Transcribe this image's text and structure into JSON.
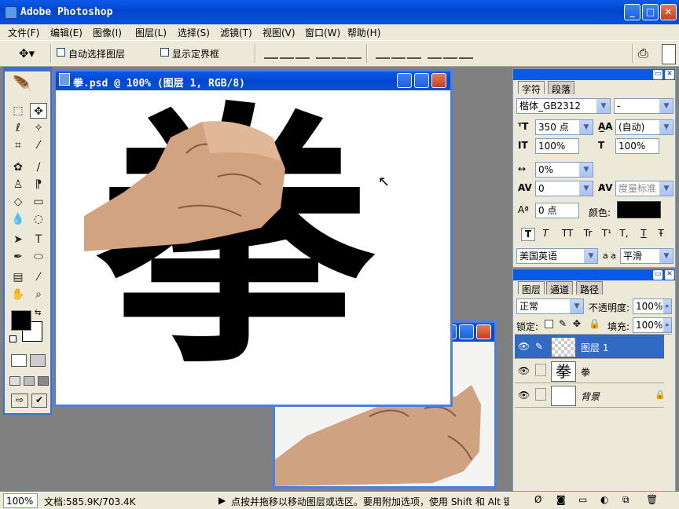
{
  "app": {
    "title": "Adobe Photoshop",
    "min": "_",
    "max": "□",
    "close": "✕"
  },
  "menu": [
    "文件(F)",
    "编辑(E)",
    "图像(I)",
    "图层(L)",
    "选择(S)",
    "滤镜(T)",
    "视图(V)",
    "窗口(W)",
    "帮助(H)"
  ],
  "options": {
    "auto_select": "自动选择图层",
    "show_bounds": "显示定界框"
  },
  "doc1": {
    "title": "拳.psd @ 100% (图层 1, RGB/8)",
    "glyph": "拳"
  },
  "doc2": {
    "title": ""
  },
  "char_panel": {
    "tabs": [
      "字符",
      "段落"
    ],
    "font_family": "楷体_GB2312",
    "font_style": "-",
    "size": "350 点",
    "leading": "(自动)",
    "vscale": "100%",
    "hscale": "100%",
    "tracking": "0%",
    "kerning": "0",
    "kern_method": "度量标准",
    "baseline": "0 点",
    "color_label": "颜色:",
    "color": "#000000",
    "styles": [
      "T",
      "T",
      "TT",
      "Tr",
      "T¹",
      "T,",
      "T",
      "Ŧ"
    ],
    "language": "美国英语",
    "aa_label": "a a",
    "aa": "平滑"
  },
  "layers_panel": {
    "tabs": [
      "图层",
      "通道",
      "路径"
    ],
    "blend": "正常",
    "opacity_label": "不透明度:",
    "opacity": "100%",
    "lock_label": "锁定:",
    "fill_label": "填充:",
    "fill": "100%",
    "layers": [
      {
        "name": "图层 1",
        "selected": true
      },
      {
        "name": "拳",
        "selected": false,
        "thumb": "拳"
      },
      {
        "name": "背景",
        "selected": false
      }
    ]
  },
  "status": {
    "zoom": "100%",
    "doc": "文档:585.9K/703.4K",
    "hint": "点按并拖移以移动图层或选区。要用附加选项，使用 Shift 和 Alt 键"
  },
  "colors": {
    "fg": "#000000",
    "bg": "#ffffff",
    "accent": "#0a5ae8"
  }
}
